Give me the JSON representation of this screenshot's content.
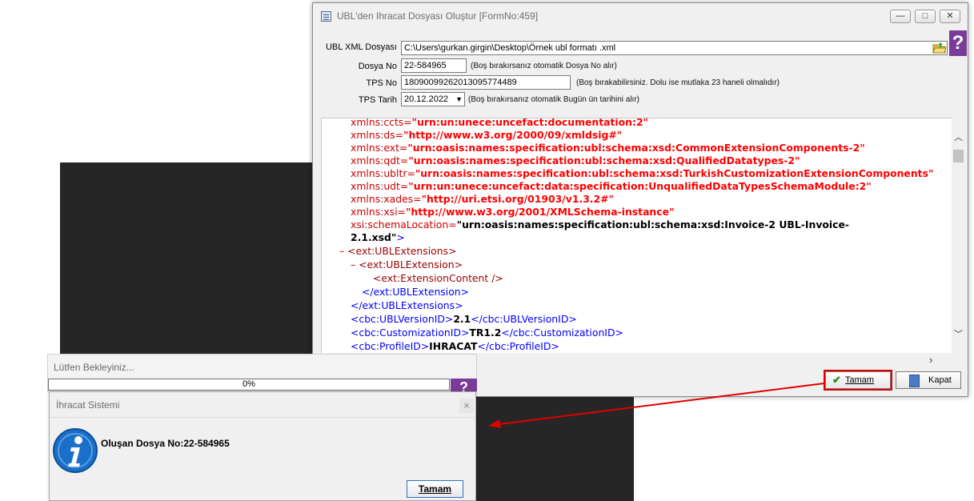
{
  "main_window": {
    "title": "UBL'den Ihracat Dosyası Oluştur [FormNo:459]",
    "controls": {
      "minimize": "—",
      "maximize": "□",
      "close": "✕"
    },
    "help_icon": "?",
    "form": {
      "ubl_xml_label": "UBL XML Dosyası",
      "ubl_xml_value": "C:\\Users\\gurkan.girgin\\Desktop\\Örnek ubl formatı .xml",
      "dosya_no_label": "Dosya No",
      "dosya_no_value": "22-584965",
      "dosya_no_hint": "(Boş bırakırsanız otomatik Dosya No alır)",
      "tps_no_label": "TPS No",
      "tps_no_value": "18090099262013095774489",
      "tps_no_hint": "(Boş bırakabilirsiniz. Dolu ise mutlaka 23 haneli olmalıdır)",
      "tps_tarih_label": "TPS Tarih",
      "tps_tarih_value": "20.12.2022",
      "tps_tarih_hint": "(Boş bırakırsanız otomatik Bugün ün tarihini alır)"
    },
    "xml_lines": [
      {
        "pre": "",
        "attr": "xmlns:ccts=",
        "val": "\"urn:un:unece:uncefact:documentation:2\""
      },
      {
        "pre": "",
        "attr": "xmlns:ds=",
        "val": "\"http://www.w3.org/2000/09/xmldsig#\""
      },
      {
        "pre": "",
        "attr": "xmlns:ext=",
        "val": "\"urn:oasis:names:specification:ubl:schema:xsd:CommonExtensionComponents-2\""
      },
      {
        "pre": "",
        "attr": "xmlns:qdt=",
        "val": "\"urn:oasis:names:specification:ubl:schema:xsd:QualifiedDatatypes-2\""
      },
      {
        "pre": "",
        "attr": "xmlns:ubltr=",
        "val": "\"urn:oasis:names:specification:ubl:schema:xsd:TurkishCustomizationExtensionComponents\""
      },
      {
        "pre": "",
        "attr": "xmlns:udt=",
        "val": "\"urn:un:unece:uncefact:data:specification:UnqualifiedDataTypesSchemaModule:2\""
      },
      {
        "pre": "",
        "attr": "xmlns:xades=",
        "val": "\"http://uri.etsi.org/01903/v1.3.2#\""
      },
      {
        "pre": "",
        "attr": "xmlns:xsi=",
        "val": "\"http://www.w3.org/2001/XMLSchema-instance\""
      }
    ],
    "schema_attr": "xsi:schemaLocation=",
    "schema_val_1": "\"urn:oasis:names:specification:ubl:schema:xsd:Invoice-2 UBL-Invoice-",
    "schema_val_2": "2.1.xsd\"",
    "schema_close": ">",
    "minus": "–",
    "ext_ubl_extensions_open": "<ext:UBLExtensions>",
    "ext_ubl_extension_open": "<ext:UBLExtension>",
    "ext_extension_content": "<ext:ExtensionContent />",
    "ext_ubl_extension_close": "</ext:UBLExtension>",
    "ext_ubl_extensions_close": "</ext:UBLExtensions>",
    "ubl_version_open": "<cbc:UBLVersionID>",
    "ubl_version_value": "2.1",
    "ubl_version_close": "</cbc:UBLVersionID>",
    "customization_open": "<cbc:CustomizationID>",
    "customization_value": "TR1.2",
    "customization_close": "</cbc:CustomizationID>",
    "profile_open": "<cbc:ProfileID>",
    "profile_value": "IHRACAT",
    "profile_close": "</cbc:ProfileID>",
    "buttons": {
      "tamam": "Tamam",
      "kapat": "Kapat"
    }
  },
  "progress_dialog": {
    "title": "Lütfen Bekleyiniz...",
    "progress_percent": 0,
    "progress_text": "0%"
  },
  "info_dialog": {
    "title": "İhracat Sistemi",
    "close": "×",
    "message": "Oluşan Dosya No:22-584965",
    "ok_button": "Tamam"
  },
  "colors": {
    "annotation_red": "#e00000",
    "help_purple": "#7a3c99",
    "info_blue": "#1a6fc9"
  }
}
